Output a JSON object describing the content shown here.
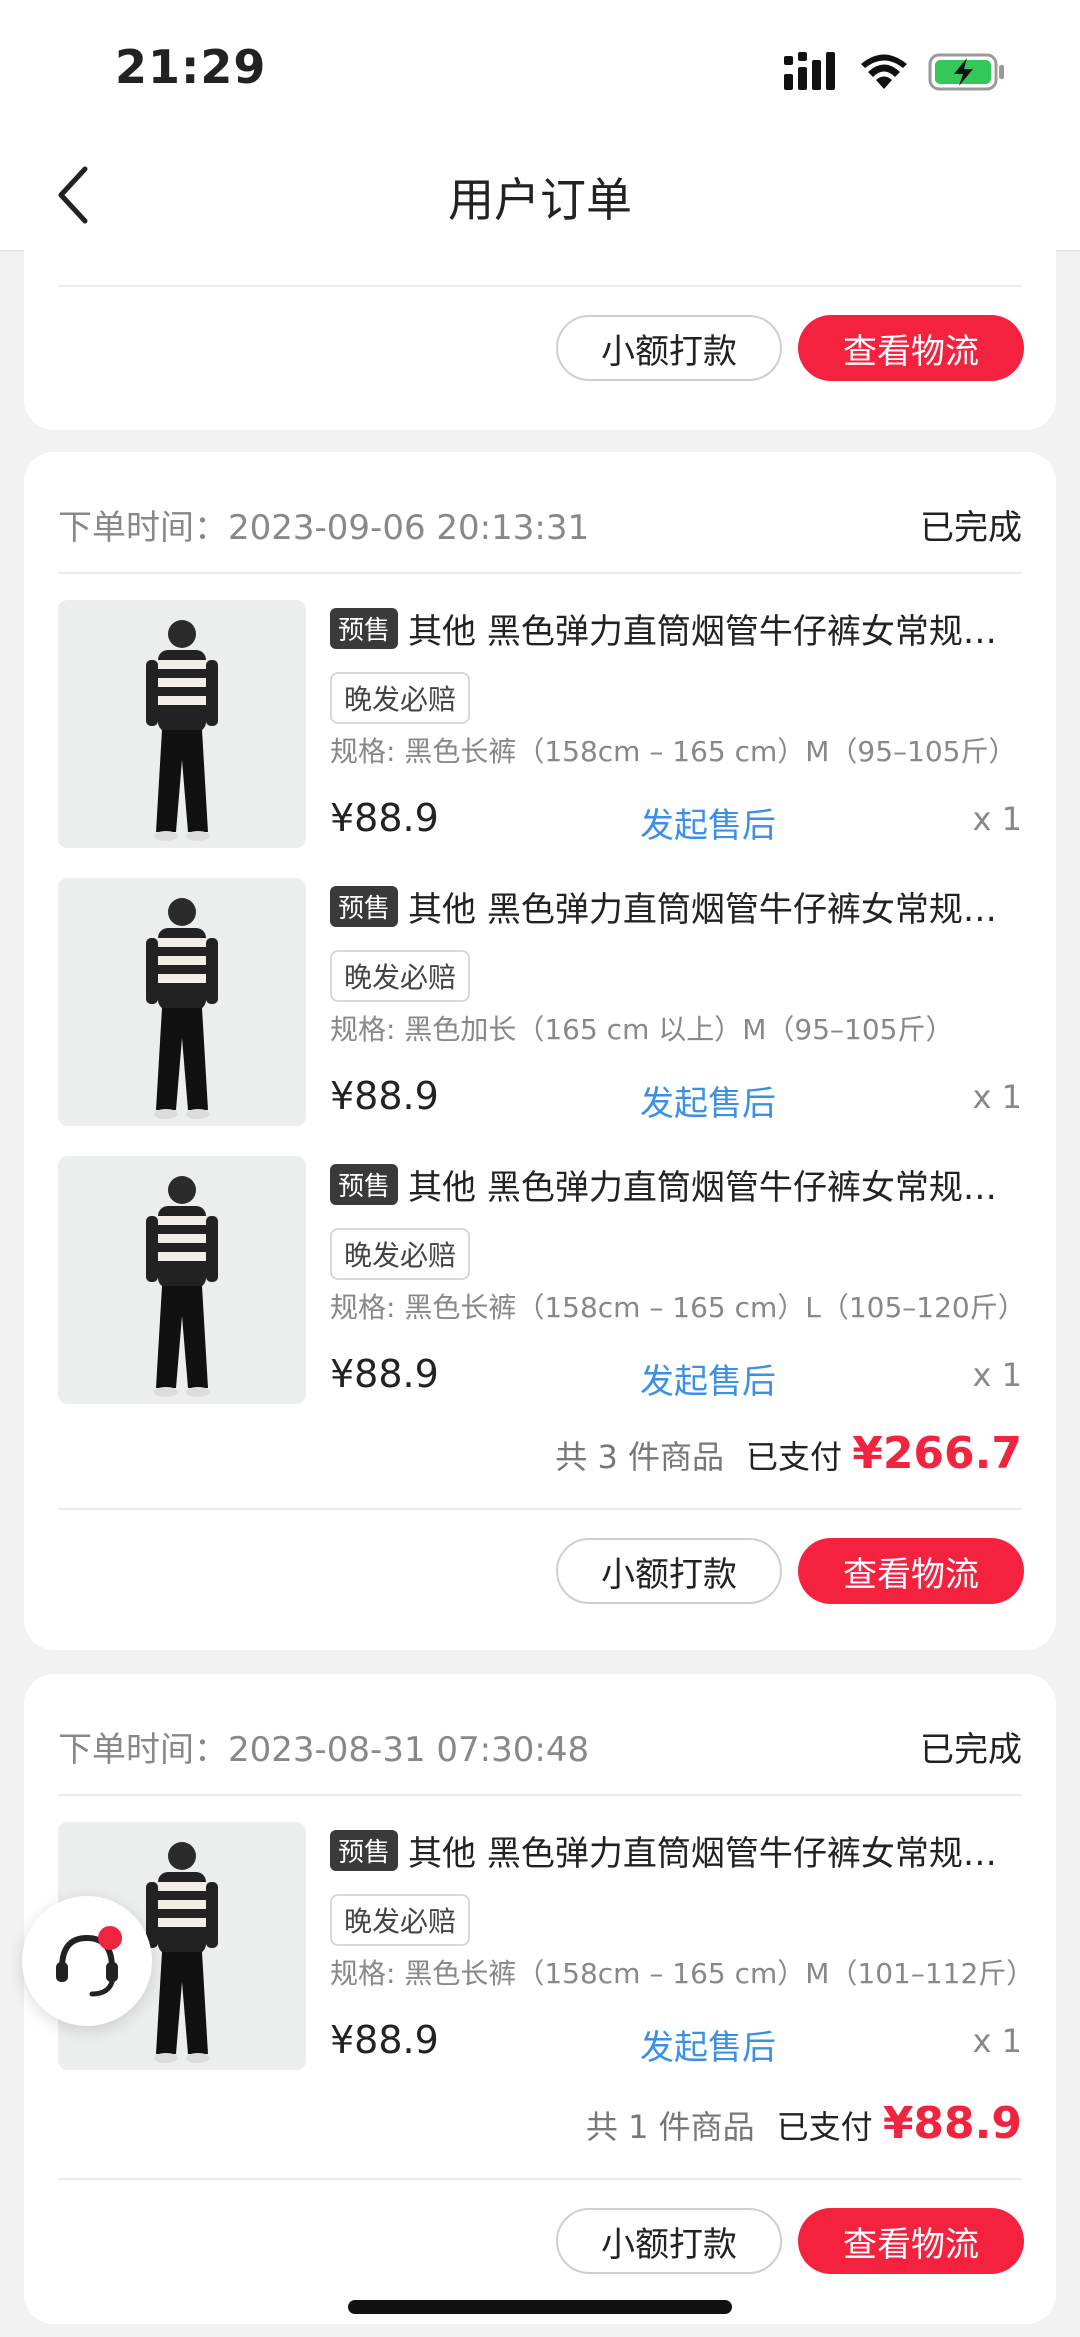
{
  "status_bar": {
    "time": "21:29"
  },
  "header": {
    "title": "用户订单"
  },
  "top_card": {
    "buttons": {
      "transfer": "小额打款",
      "logistics": "查看物流"
    }
  },
  "orders": [
    {
      "time_label": "下单时间：2023-09-06 20:13:31",
      "status": "已完成",
      "items": [
        {
          "presale": "预售",
          "title": "其他 黑色弹力直筒烟管牛仔裤女常规…",
          "tag": "晚发必赔",
          "spec": "规格: 黑色长裤（158cm – 165 cm）M（95–105斤）",
          "price": "¥88.9",
          "after_sale": "发起售后",
          "qty": "x 1"
        },
        {
          "presale": "预售",
          "title": "其他 黑色弹力直筒烟管牛仔裤女常规…",
          "tag": "晚发必赔",
          "spec": "规格: 黑色加长（165 cm 以上）M（95–105斤）",
          "price": "¥88.9",
          "after_sale": "发起售后",
          "qty": "x 1"
        },
        {
          "presale": "预售",
          "title": "其他 黑色弹力直筒烟管牛仔裤女常规…",
          "tag": "晚发必赔",
          "spec": "规格: 黑色长裤（158cm – 165 cm）L（105–120斤）",
          "price": "¥88.9",
          "after_sale": "发起售后",
          "qty": "x 1"
        }
      ],
      "summary": {
        "count": "共 3 件商品",
        "paid_label": "已支付",
        "total": "¥266.7"
      },
      "buttons": {
        "transfer": "小额打款",
        "logistics": "查看物流"
      }
    },
    {
      "time_label": "下单时间：2023-08-31 07:30:48",
      "status": "已完成",
      "items": [
        {
          "presale": "预售",
          "title": "其他 黑色弹力直筒烟管牛仔裤女常规…",
          "tag": "晚发必赔",
          "spec": "规格: 黑色长裤（158cm – 165 cm）M（101–112斤）",
          "price": "¥88.9",
          "after_sale": "发起售后",
          "qty": "x 1"
        }
      ],
      "summary": {
        "count": "共 1 件商品",
        "paid_label": "已支付",
        "total": "¥88.9"
      },
      "buttons": {
        "transfer": "小额打款",
        "logistics": "查看物流"
      }
    }
  ],
  "icons": {
    "back": "chevron-left-icon",
    "signal": "signal-icon",
    "wifi": "wifi-icon",
    "battery": "battery-charging-icon",
    "customer_service": "headset-icon"
  },
  "colors": {
    "accent_red": "#f5223f",
    "link_blue": "#3b8fe6",
    "battery_green": "#34c759"
  }
}
